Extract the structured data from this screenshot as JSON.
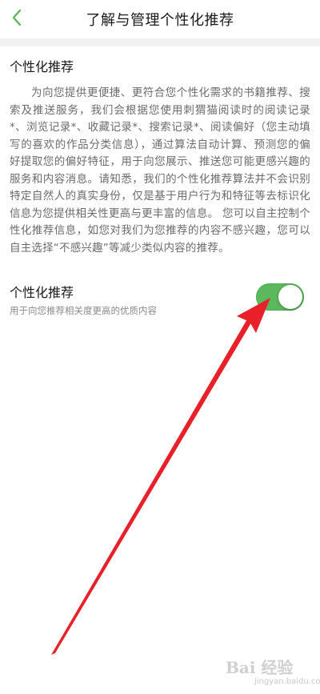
{
  "header": {
    "title": "了解与管理个性化推荐",
    "back_icon": "chevron-left-icon",
    "accent": "#5cb85c"
  },
  "section": {
    "title": "个性化推荐",
    "description": "为向您提供更便捷、更符合您个性化需求的书籍推荐、搜索及推送服务，我们会根据您使用刺猬猫阅读时的阅读记录*、浏览记录*、收藏记录*、搜索记录*、阅读偏好（您主动填写的喜欢的作品分类信息），通过算法自动计算、预测您的偏好提取您的偏好特征，用于向您展示、推送您可能更感兴趣的服务和内容消息。请知悉，我们的个性化推荐算法并不会识别特定自然人的真实身份，仅是基于用户行为和特征等去标识化信息为您提供相关性更高与更丰富的信息。 您可以自主控制个性化推荐信息，如您对我们为您推荐的内容不感兴趣，您可以自主选择“不感兴趣”等减少类似内容的推荐。"
  },
  "setting": {
    "title": "个性化推荐",
    "subtitle": "用于向您推荐相关度更高的优质内容",
    "enabled": true,
    "on_color": "#5cb85c"
  },
  "overlay": {
    "annotation": "red-arrow",
    "color": "#e8202a"
  },
  "watermark": {
    "text": "Bai 经验",
    "sub": "jingyan.baidu.com"
  }
}
